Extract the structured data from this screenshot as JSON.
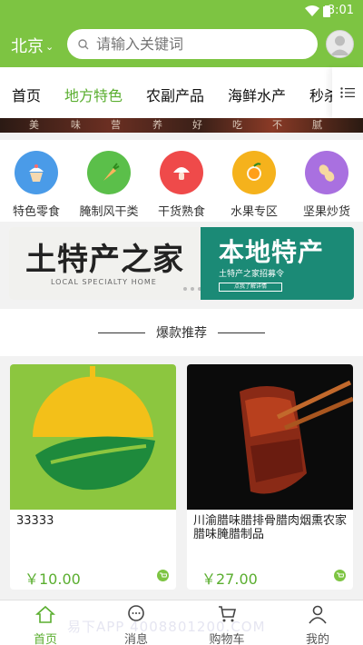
{
  "status": {
    "time": "8:01"
  },
  "header": {
    "city": "北京",
    "search_placeholder": "请输入关键词"
  },
  "tabs": [
    "首页",
    "地方特色",
    "农副产品",
    "海鲜水产",
    "秒杀"
  ],
  "active_tab": 1,
  "banner_strip_text": [
    "美",
    "味",
    "营",
    "养",
    "好",
    "吃",
    "不",
    "腻"
  ],
  "categories": [
    {
      "label": "特色零食",
      "icon": "cupcake-icon",
      "color": "#4a9be8"
    },
    {
      "label": "腌制风干类",
      "icon": "carrot-icon",
      "color": "#5bbf4a"
    },
    {
      "label": "干货熟食",
      "icon": "mushroom-icon",
      "color": "#ef4a4a"
    },
    {
      "label": "水果专区",
      "icon": "orange-icon",
      "color": "#f5b21c"
    },
    {
      "label": "坚果炒货",
      "icon": "peanut-icon",
      "color": "#a970e0"
    }
  ],
  "promo": {
    "left_title": "土特产之家",
    "left_sub": "LOCAL SPECIALTY HOME",
    "right_title": "本地特产",
    "right_sub": "土特产之家招募令",
    "right_btn": "点我了解详情"
  },
  "section_title": "爆款推荐",
  "products": [
    {
      "name": "33333",
      "price": "￥10.00"
    },
    {
      "name": "川渝腊味腊排骨腊肉烟熏农家腊味腌腊制品",
      "price": "￥27.00"
    }
  ],
  "bottom_nav": [
    {
      "label": "首页",
      "icon": "home-icon",
      "active": true
    },
    {
      "label": "消息",
      "icon": "message-icon",
      "active": false
    },
    {
      "label": "购物车",
      "icon": "cart-icon",
      "active": false
    },
    {
      "label": "我的",
      "icon": "user-icon",
      "active": false
    }
  ],
  "watermark": "易下APP 4008801200.COM",
  "colors": {
    "brand": "#7dc442",
    "accent": "#5aae2f"
  }
}
